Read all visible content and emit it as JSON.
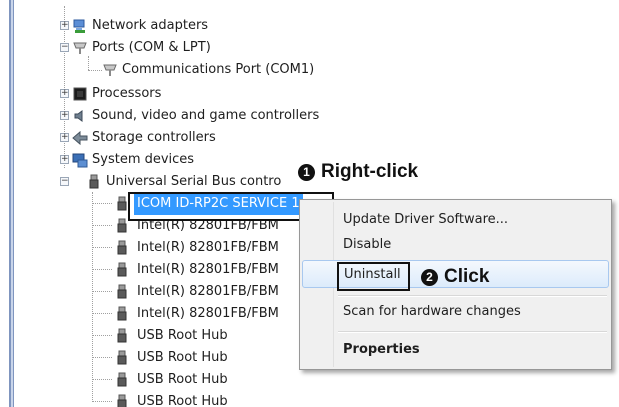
{
  "tree": {
    "network_adapters": "Network adapters",
    "ports": "Ports (COM & LPT)",
    "comm_port": "Communications Port (COM1)",
    "processors": "Processors",
    "sound": "Sound, video and game controllers",
    "storage": "Storage controllers",
    "system_devices": "System devices",
    "usb_controllers": "Universal Serial Bus contro",
    "usb_children": [
      "ICOM ID-RP2C SERVICE 1",
      "Intel(R) 82801FB/FBM",
      "Intel(R) 82801FB/FBM",
      "Intel(R) 82801FB/FBM",
      "Intel(R) 82801FB/FBM",
      "Intel(R) 82801FB/FBM",
      "USB Root Hub",
      "USB Root Hub",
      "USB Root Hub",
      "USB Root Hub"
    ]
  },
  "context_menu": {
    "update": "Update Driver Software...",
    "disable": "Disable",
    "uninstall": "Uninstall",
    "scan": "Scan for hardware changes",
    "properties": "Properties"
  },
  "callouts": {
    "step1_num": "1",
    "step1_text": "Right-click",
    "step2_num": "2",
    "step2_text": "Click"
  }
}
